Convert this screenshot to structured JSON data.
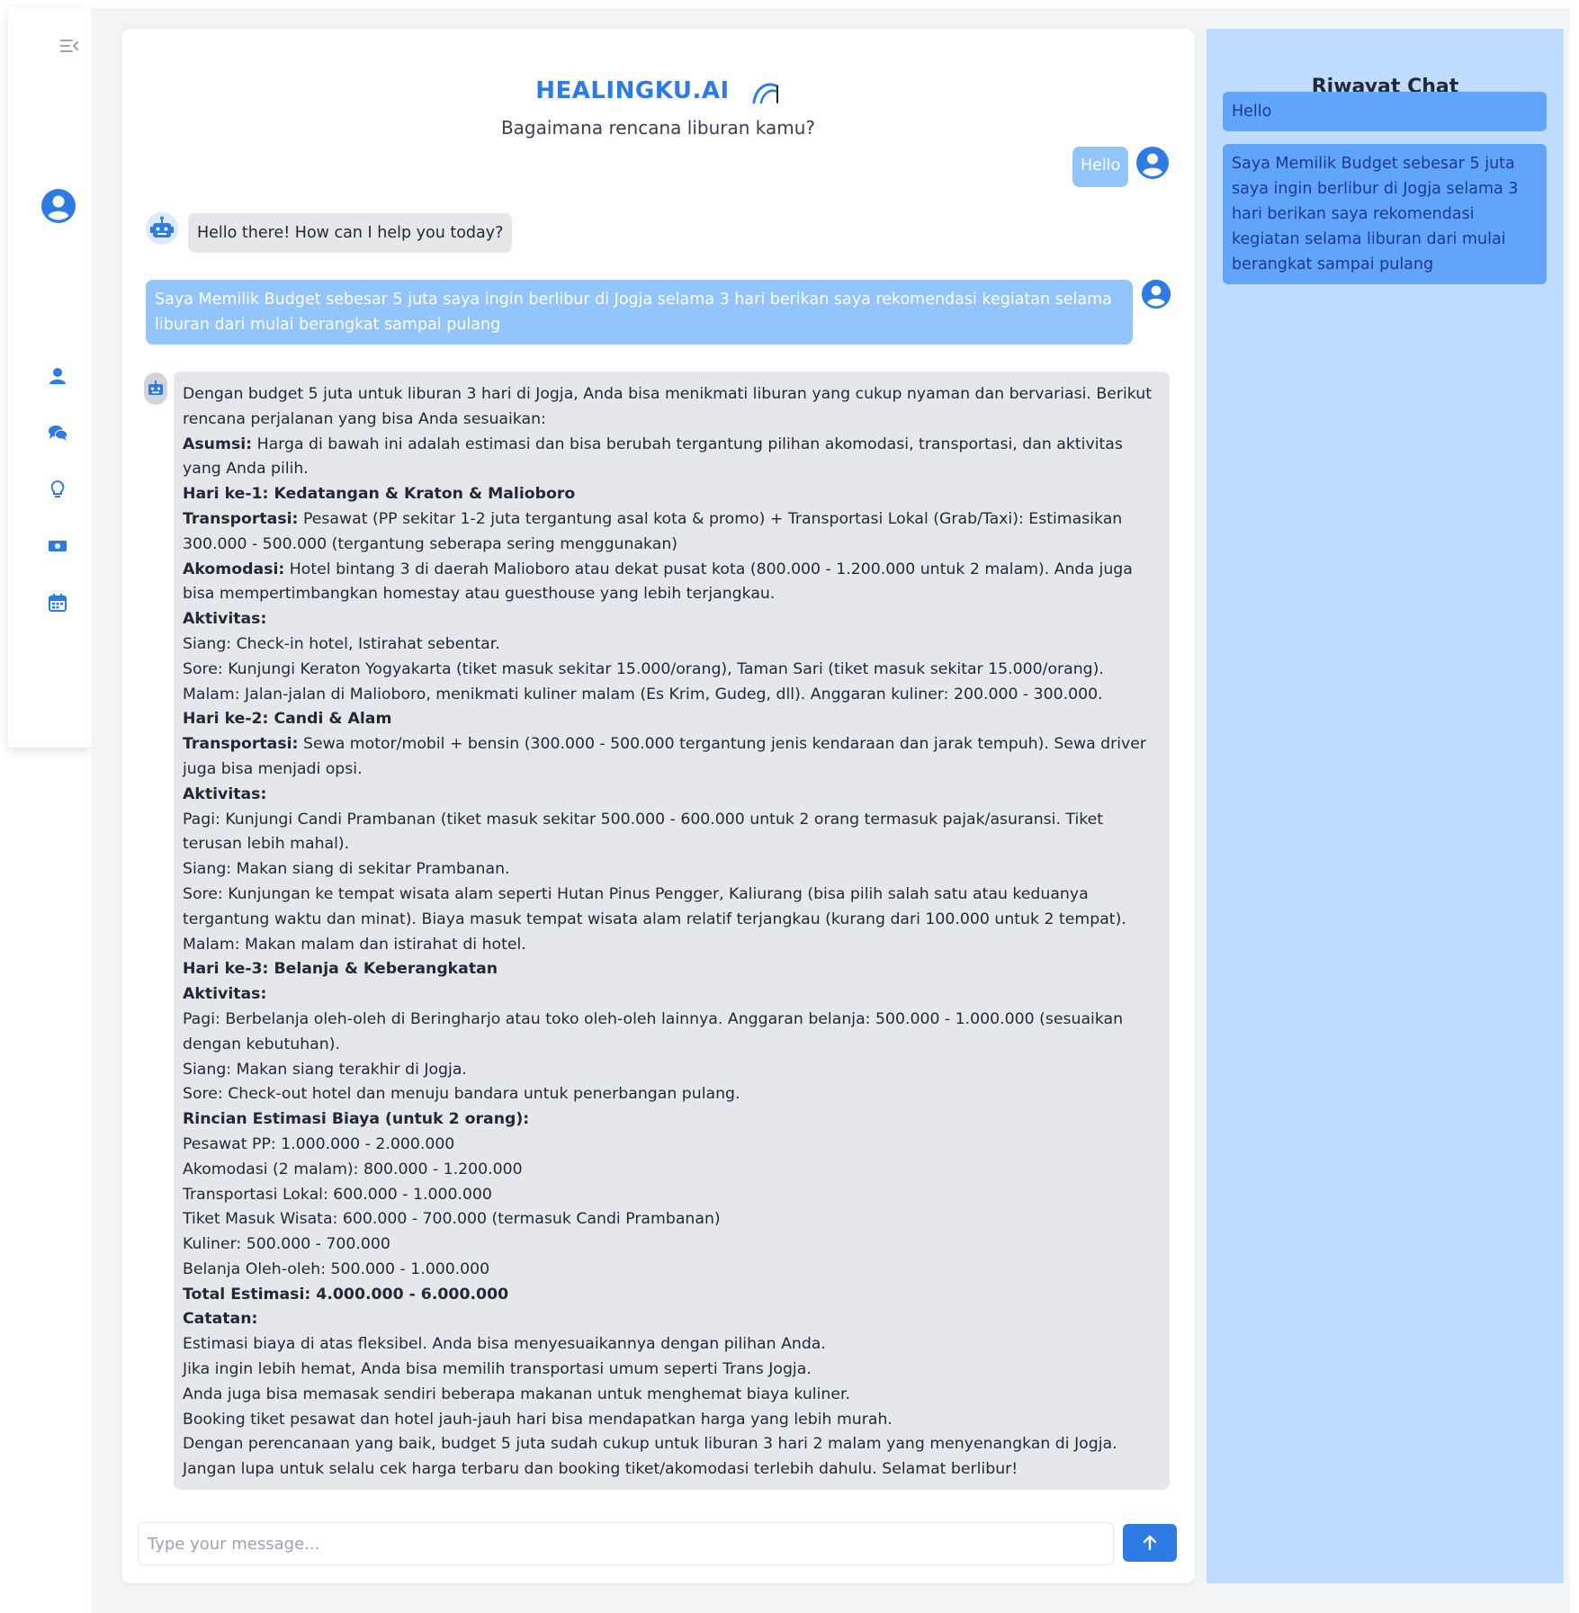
{
  "app": {
    "title": "HEALINGKU.AI",
    "subtitle": "Bagaimana rencana liburan kamu?"
  },
  "colors": {
    "brand": "#2f7be4",
    "user_bubble": "#93c5fd",
    "bot_bubble": "#e5e7eb",
    "history_bg": "#bfdbfe",
    "history_item": "#60a5fa"
  },
  "sidebar": {
    "toggle_icon": "menu-collapse-icon",
    "avatar_icon": "user-circle-icon",
    "items": [
      {
        "name": "profile",
        "icon": "user-icon"
      },
      {
        "name": "chat",
        "icon": "comments-icon"
      },
      {
        "name": "ideas",
        "icon": "lightbulb-icon"
      },
      {
        "name": "budget",
        "icon": "money-icon"
      },
      {
        "name": "calendar",
        "icon": "calendar-icon"
      }
    ]
  },
  "chat": {
    "messages": [
      {
        "role": "user",
        "text": "Hello"
      },
      {
        "role": "bot",
        "text": "Hello there! How can I help you today?"
      },
      {
        "role": "user",
        "text": "Saya Memilik Budget sebesar 5 juta saya ingin berlibur di Jogja selama 3 hari berikan saya rekomendasi kegiatan selama liburan dari mulai berangkat sampai pulang"
      }
    ],
    "response": [
      {
        "bold": "",
        "text": "Dengan budget 5 juta untuk liburan 3 hari di Jogja, Anda bisa menikmati liburan yang cukup nyaman dan bervariasi. Berikut rencana perjalanan yang bisa Anda sesuaikan:"
      },
      {
        "bold": "Asumsi:",
        "text": " Harga di bawah ini adalah estimasi dan bisa berubah tergantung pilihan akomodasi, transportasi, dan aktivitas yang Anda pilih."
      },
      {
        "bold": "Hari ke-1: Kedatangan & Kraton & Malioboro",
        "text": ""
      },
      {
        "bold": "Transportasi:",
        "text": " Pesawat (PP sekitar 1-2 juta tergantung asal kota & promo) + Transportasi Lokal (Grab/Taxi): Estimasikan 300.000 - 500.000 (tergantung seberapa sering menggunakan)"
      },
      {
        "bold": "Akomodasi:",
        "text": " Hotel bintang 3 di daerah Malioboro atau dekat pusat kota (800.000 - 1.200.000 untuk 2 malam). Anda juga bisa mempertimbangkan homestay atau guesthouse yang lebih terjangkau."
      },
      {
        "bold": "Aktivitas:",
        "text": ""
      },
      {
        "bold": "",
        "text": "Siang: Check-in hotel, Istirahat sebentar."
      },
      {
        "bold": "",
        "text": "Sore: Kunjungi Keraton Yogyakarta (tiket masuk sekitar 15.000/orang), Taman Sari (tiket masuk sekitar 15.000/orang)."
      },
      {
        "bold": "",
        "text": "Malam: Jalan-jalan di Malioboro, menikmati kuliner malam (Es Krim, Gudeg, dll). Anggaran kuliner: 200.000 - 300.000."
      },
      {
        "bold": "Hari ke-2: Candi & Alam",
        "text": ""
      },
      {
        "bold": "Transportasi:",
        "text": " Sewa motor/mobil + bensin (300.000 - 500.000 tergantung jenis kendaraan dan jarak tempuh). Sewa driver juga bisa menjadi opsi."
      },
      {
        "bold": "Aktivitas:",
        "text": ""
      },
      {
        "bold": "",
        "text": "Pagi: Kunjungi Candi Prambanan (tiket masuk sekitar 500.000 - 600.000 untuk 2 orang termasuk pajak/asuransi. Tiket terusan lebih mahal)."
      },
      {
        "bold": "",
        "text": "Siang: Makan siang di sekitar Prambanan."
      },
      {
        "bold": "",
        "text": "Sore: Kunjungan ke tempat wisata alam seperti Hutan Pinus Pengger, Kaliurang (bisa pilih salah satu atau keduanya tergantung waktu dan minat). Biaya masuk tempat wisata alam relatif terjangkau (kurang dari 100.000 untuk 2 tempat)."
      },
      {
        "bold": "",
        "text": "Malam: Makan malam dan istirahat di hotel."
      },
      {
        "bold": "Hari ke-3: Belanja & Keberangkatan",
        "text": ""
      },
      {
        "bold": "Aktivitas:",
        "text": ""
      },
      {
        "bold": "",
        "text": "Pagi: Berbelanja oleh-oleh di Beringharjo atau toko oleh-oleh lainnya. Anggaran belanja: 500.000 - 1.000.000 (sesuaikan dengan kebutuhan)."
      },
      {
        "bold": "",
        "text": "Siang: Makan siang terakhir di Jogja."
      },
      {
        "bold": "",
        "text": "Sore: Check-out hotel dan menuju bandara untuk penerbangan pulang."
      },
      {
        "bold": "Rincian Estimasi Biaya (untuk 2 orang):",
        "text": ""
      },
      {
        "bold": "",
        "text": "Pesawat PP: 1.000.000 - 2.000.000"
      },
      {
        "bold": "",
        "text": "Akomodasi (2 malam): 800.000 - 1.200.000"
      },
      {
        "bold": "",
        "text": "Transportasi Lokal: 600.000 - 1.000.000"
      },
      {
        "bold": "",
        "text": "Tiket Masuk Wisata: 600.000 - 700.000 (termasuk Candi Prambanan)"
      },
      {
        "bold": "",
        "text": "Kuliner: 500.000 - 700.000"
      },
      {
        "bold": "",
        "text": "Belanja Oleh-oleh: 500.000 - 1.000.000"
      },
      {
        "bold": "Total Estimasi: 4.000.000 - 6.000.000",
        "text": ""
      },
      {
        "bold": "Catatan:",
        "text": ""
      },
      {
        "bold": "",
        "text": "Estimasi biaya di atas fleksibel. Anda bisa menyesuaikannya dengan pilihan Anda."
      },
      {
        "bold": "",
        "text": "Jika ingin lebih hemat, Anda bisa memilih transportasi umum seperti Trans Jogja."
      },
      {
        "bold": "",
        "text": "Anda juga bisa memasak sendiri beberapa makanan untuk menghemat biaya kuliner."
      },
      {
        "bold": "",
        "text": "Booking tiket pesawat dan hotel jauh-jauh hari bisa mendapatkan harga yang lebih murah."
      },
      {
        "bold": "",
        "text": "Dengan perencanaan yang baik, budget 5 juta sudah cukup untuk liburan 3 hari 2 malam yang menyenangkan di Jogja. Jangan lupa untuk selalu cek harga terbaru dan booking tiket/akomodasi terlebih dahulu. Selamat berlibur!"
      }
    ]
  },
  "input": {
    "placeholder": "Type your message...",
    "send_icon": "arrow-up-icon"
  },
  "history": {
    "title": "Riwayat Chat",
    "items": [
      "Hello",
      "Saya Memilik Budget sebesar 5 juta saya ingin berlibur di Jogja selama 3 hari berikan saya rekomendasi kegiatan selama liburan dari mulai berangkat sampai pulang"
    ]
  }
}
